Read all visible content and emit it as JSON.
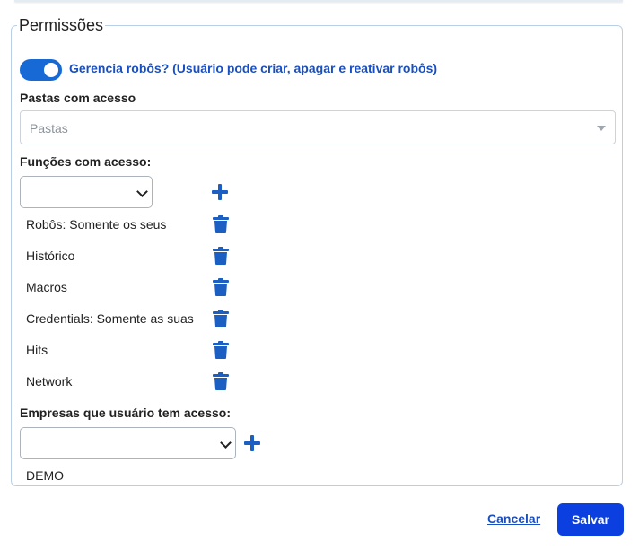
{
  "permissoes": {
    "legend": "Permissões",
    "toggle": {
      "checked": true,
      "label": "Gerencia robôs? (Usuário pode criar, apagar e reativar robôs)"
    },
    "pastas": {
      "label": "Pastas com acesso",
      "placeholder": "Pastas"
    },
    "funcoes": {
      "label": "Funções com acesso:",
      "select_value": "",
      "items": [
        "Robôs: Somente os seus",
        "Histórico",
        "Macros",
        "Credentials: Somente as suas",
        "Hits",
        "Network"
      ]
    },
    "empresas": {
      "label": "Empresas que usuário tem acesso:",
      "select_value": "",
      "items": [
        "DEMO"
      ]
    }
  },
  "footer": {
    "cancel_label": "Cancelar",
    "save_label": "Salvar"
  },
  "colors": {
    "accent": "#1769d6",
    "primary_button": "#0b3fe0",
    "link": "#1a4fbf",
    "fieldset_border": "#b9cfe6"
  },
  "icons": {
    "add": "plus-icon",
    "remove": "trash-icon",
    "dropdown": "chevron-down-icon"
  }
}
